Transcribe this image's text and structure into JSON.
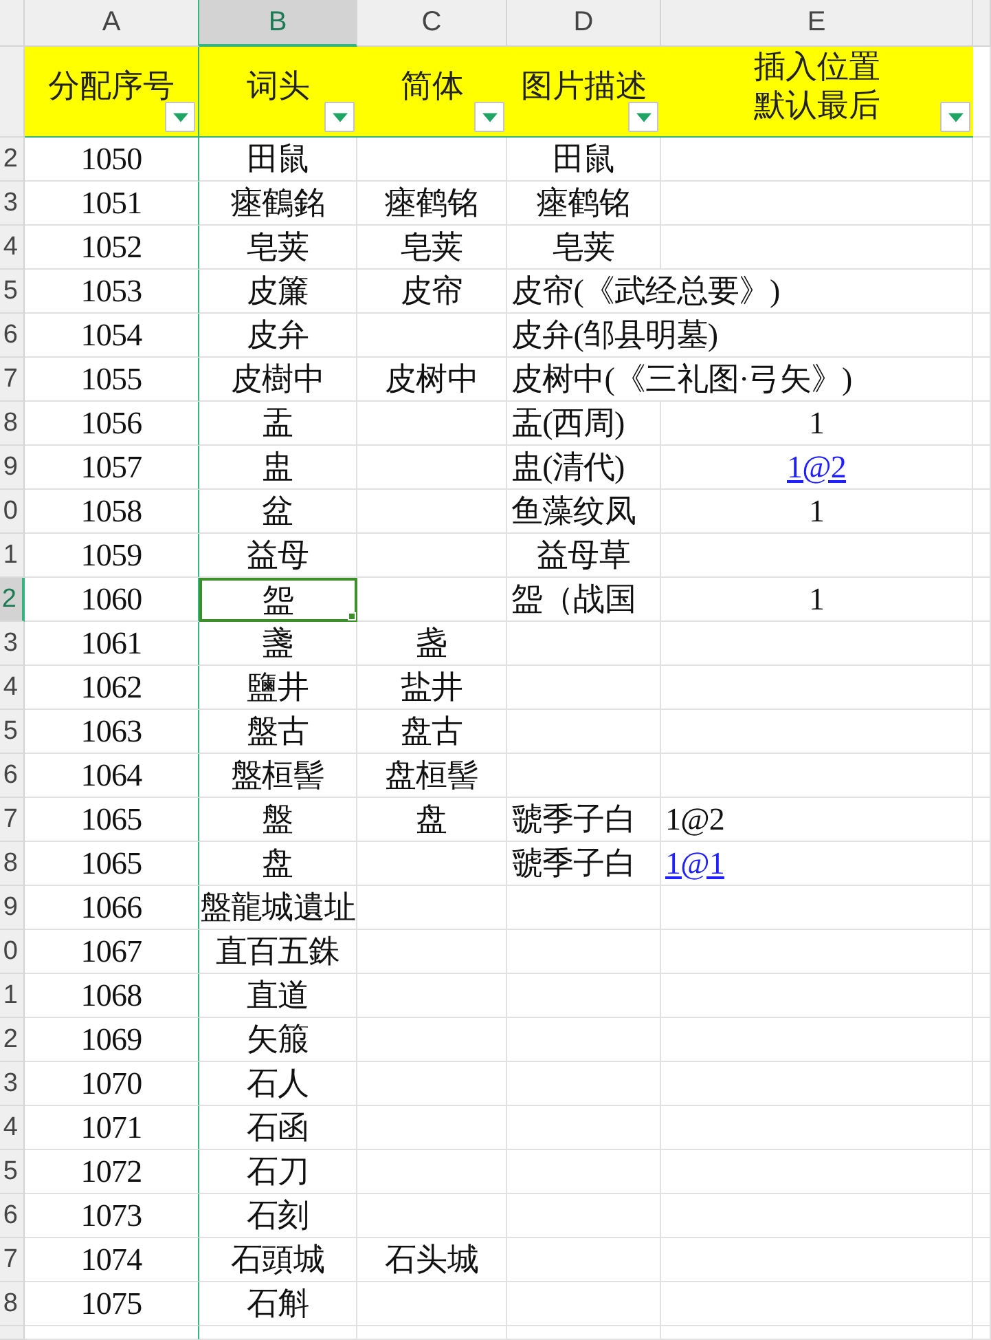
{
  "column_letters": [
    {
      "label": "A",
      "selected": false
    },
    {
      "label": "B",
      "selected": true
    },
    {
      "label": "C",
      "selected": false
    },
    {
      "label": "D",
      "selected": false
    },
    {
      "label": "E",
      "selected": false
    }
  ],
  "header_row": [
    {
      "label": "分配序号",
      "filter": true
    },
    {
      "label": "词头",
      "filter": true
    },
    {
      "label": "简体",
      "filter": true
    },
    {
      "label": "图片描述",
      "filter": true
    },
    {
      "label": "插入位置默认最后",
      "filter": true
    }
  ],
  "rows": [
    {
      "row_number": "2",
      "selected": false,
      "number": "1050",
      "headword": "田鼠",
      "image_description": {
        "text": "田鼠",
        "centered": true
      }
    },
    {
      "row_number": "3",
      "selected": false,
      "number": "1051",
      "headword": "瘞鶴銘",
      "simplified": "瘞鹤铭",
      "image_description": {
        "text": "瘞鹤铭",
        "centered": true
      }
    },
    {
      "row_number": "4",
      "selected": false,
      "number": "1052",
      "headword": "皂荚",
      "simplified": "皂荚",
      "image_description": {
        "text": "皂荚",
        "centered": true
      }
    },
    {
      "row_number": "5",
      "selected": false,
      "number": "1053",
      "headword": "皮簾",
      "simplified": "皮帘",
      "image_description": {
        "text": "皮帘(《武经总要》)",
        "centered": false
      }
    },
    {
      "row_number": "6",
      "selected": false,
      "number": "1054",
      "headword": "皮弁",
      "image_description": {
        "text": "皮弁(邹县明墓)",
        "centered": false
      }
    },
    {
      "row_number": "7",
      "selected": false,
      "number": "1055",
      "headword": "皮樹中",
      "simplified": "皮树中",
      "image_description": {
        "text": "皮树中(《三礼图·弓矢》)",
        "centered": false
      }
    },
    {
      "row_number": "8",
      "selected": false,
      "number": "1056",
      "headword": "盂",
      "image_description": {
        "text": "盂(西周)",
        "centered": false
      },
      "insert_position": {
        "text": "1",
        "centered": true,
        "link": false
      }
    },
    {
      "row_number": "9",
      "selected": false,
      "number": "1057",
      "headword": "盅",
      "image_description": {
        "text": "盅(清代)",
        "centered": false
      },
      "insert_position": {
        "text": "1@2",
        "centered": true,
        "link": true
      }
    },
    {
      "row_number": "0",
      "selected": false,
      "number": "1058",
      "headword": "盆",
      "image_description": {
        "text": "鱼藻纹凤",
        "centered": false
      },
      "insert_position": {
        "text": "1",
        "centered": true,
        "link": false
      }
    },
    {
      "row_number": "1",
      "selected": false,
      "number": "1059",
      "headword": "益母",
      "image_description": {
        "text": "益母草",
        "centered": true
      }
    },
    {
      "row_number": "2",
      "selected": true,
      "number": "1060",
      "headword": "盌",
      "image_description": {
        "text": "盌（战国",
        "centered": false
      },
      "insert_position": {
        "text": "1",
        "centered": true,
        "link": false
      }
    },
    {
      "row_number": "3",
      "selected": false,
      "number": "1061",
      "headword": "盞",
      "simplified": "盏"
    },
    {
      "row_number": "4",
      "selected": false,
      "number": "1062",
      "headword": "鹽井",
      "simplified": "盐井"
    },
    {
      "row_number": "5",
      "selected": false,
      "number": "1063",
      "headword": "盤古",
      "simplified": "盘古"
    },
    {
      "row_number": "6",
      "selected": false,
      "number": "1064",
      "headword": "盤桓髻",
      "simplified": "盘桓髻"
    },
    {
      "row_number": "7",
      "selected": false,
      "number": "1065",
      "headword": "盤",
      "simplified": "盘",
      "image_description": {
        "text": "虢季子白",
        "centered": false
      },
      "insert_position": {
        "text": "1@2",
        "centered": false,
        "link": false
      }
    },
    {
      "row_number": "8",
      "selected": false,
      "number": "1065",
      "headword": "盘",
      "image_description": {
        "text": "虢季子白",
        "centered": false
      },
      "insert_position": {
        "text": "1@1",
        "centered": false,
        "link": true
      }
    },
    {
      "row_number": "9",
      "selected": false,
      "number": "1066",
      "headword": "盤龍城遺址"
    },
    {
      "row_number": "0",
      "selected": false,
      "number": "1067",
      "headword": "直百五銖"
    },
    {
      "row_number": "1",
      "selected": false,
      "number": "1068",
      "headword": "直道"
    },
    {
      "row_number": "2",
      "selected": false,
      "number": "1069",
      "headword": "矢箙"
    },
    {
      "row_number": "3",
      "selected": false,
      "number": "1070",
      "headword": "石人"
    },
    {
      "row_number": "4",
      "selected": false,
      "number": "1071",
      "headword": "石函"
    },
    {
      "row_number": "5",
      "selected": false,
      "number": "1072",
      "headword": "石刀"
    },
    {
      "row_number": "6",
      "selected": false,
      "number": "1073",
      "headword": "石刻"
    },
    {
      "row_number": "7",
      "selected": false,
      "number": "1074",
      "headword": "石頭城",
      "simplified": "石头城"
    },
    {
      "row_number": "8",
      "selected": false,
      "number": "1075",
      "headword": "石斛"
    }
  ]
}
